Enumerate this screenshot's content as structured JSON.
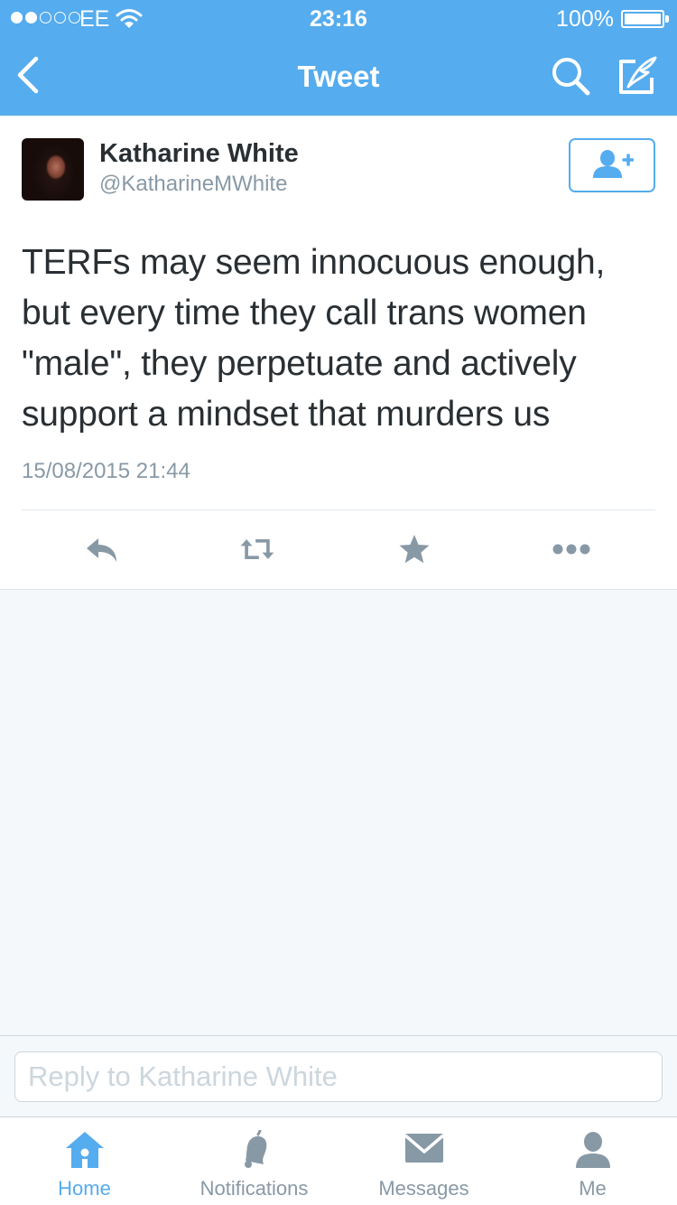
{
  "colors": {
    "accent": "#55acee",
    "muted": "#8899a6",
    "text": "#292f33",
    "background": "#f5f8fa"
  },
  "status_bar": {
    "carrier": "EE",
    "time": "23:16",
    "battery": "100%",
    "battery_level": 1.0,
    "signal_bars_filled": 2,
    "signal_bars_total": 5
  },
  "nav": {
    "title": "Tweet",
    "icons": [
      "chevron-left-icon",
      "search-icon",
      "compose-icon"
    ]
  },
  "tweet": {
    "author_name": "Katharine White",
    "author_handle": "@KatharineMWhite",
    "follow_icon": "add-user-icon",
    "text_lines": [
      "TERFs may seem innocuous enough,",
      "but every time they call trans women",
      "\"male\", they perpetuate and actively",
      "support a mindset that murders us"
    ],
    "timestamp": "15/08/2015 21:44",
    "actions": [
      "reply-icon",
      "retweet-icon",
      "favorite-icon",
      "more-icon"
    ]
  },
  "reply": {
    "value": "",
    "placeholder": "Reply to Katharine White"
  },
  "tabs": [
    {
      "label": "Home",
      "icon": "home-icon",
      "active": true
    },
    {
      "label": "Notifications",
      "icon": "bell-icon",
      "active": false
    },
    {
      "label": "Messages",
      "icon": "envelope-icon",
      "active": false
    },
    {
      "label": "Me",
      "icon": "person-icon",
      "active": false
    }
  ]
}
